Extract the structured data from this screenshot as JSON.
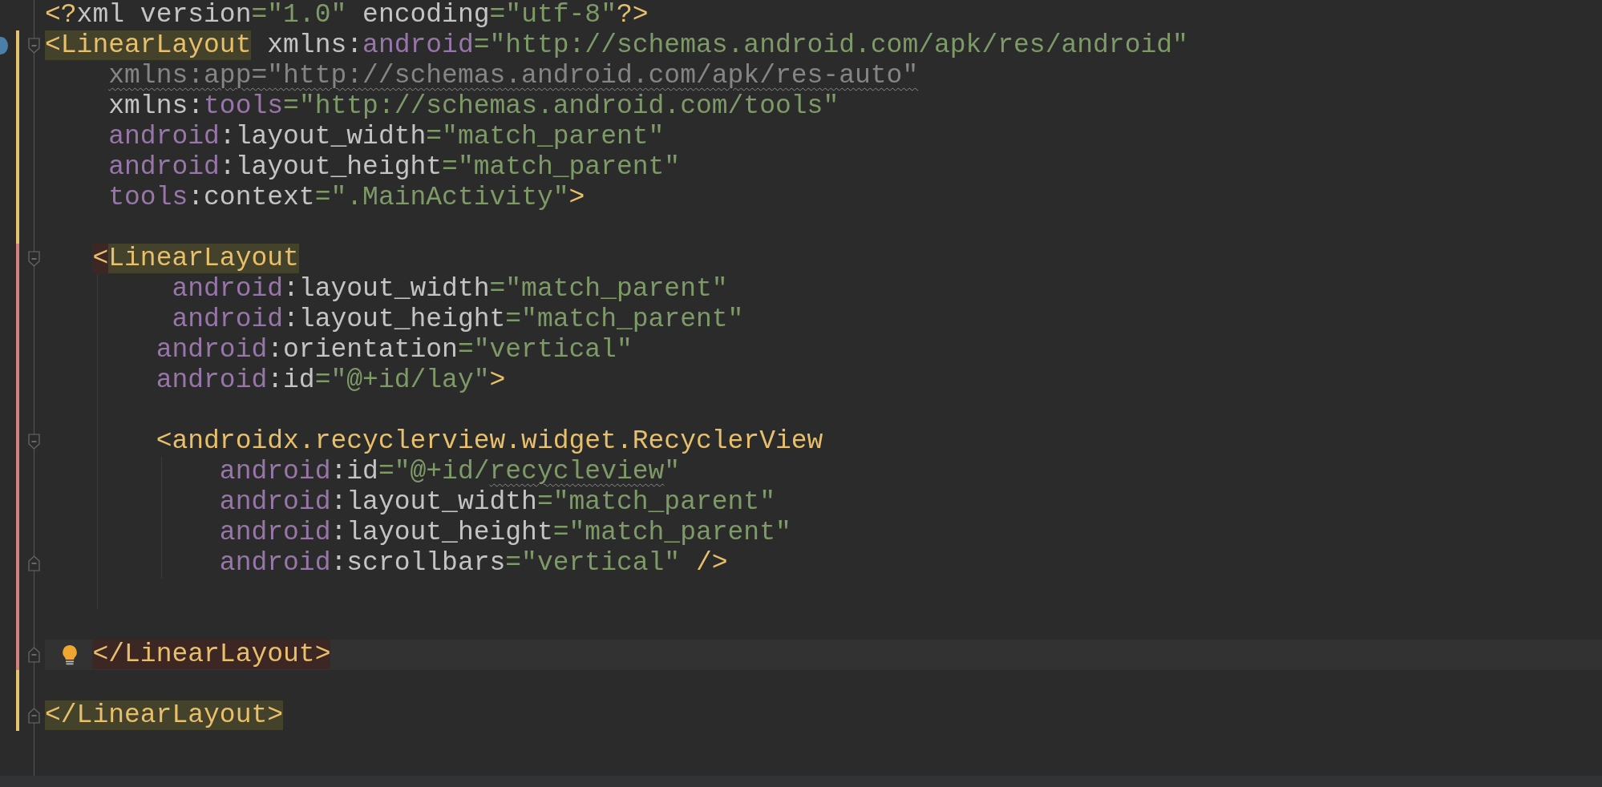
{
  "editor": {
    "lines": [
      {
        "tokens": [
          {
            "kind": "tag",
            "text": "<?"
          },
          {
            "kind": "attr",
            "text": "xml version"
          },
          {
            "kind": "value",
            "text": "=\"1.0\""
          },
          {
            "kind": "attr",
            "text": " encoding"
          },
          {
            "kind": "value",
            "text": "=\"utf-8\""
          },
          {
            "kind": "tag",
            "text": "?>"
          }
        ]
      },
      {
        "color": "#e3c46e",
        "dot": true,
        "fold_start": true,
        "tokens": [
          {
            "kind": "tag",
            "text": "<LinearLayout",
            "matched": true
          },
          {
            "kind": "attr",
            "text": " xmlns:"
          },
          {
            "kind": "ns",
            "text": "android"
          },
          {
            "kind": "value",
            "text": "=\"http://schemas.android.com/apk/res/android\""
          }
        ]
      },
      {
        "color": "#e3c46e",
        "tokens": [
          {
            "kind": "unused",
            "text": "    xmlns:app=\"http://schemas.android.com/apk/res-auto\"",
            "squiggle": true
          }
        ]
      },
      {
        "color": "#e3c46e",
        "tokens": [
          {
            "kind": "attr",
            "text": "    xmlns:"
          },
          {
            "kind": "ns",
            "text": "tools"
          },
          {
            "kind": "value",
            "text": "=\"http://schemas.android.com/tools\""
          }
        ]
      },
      {
        "color": "#e3c46e",
        "tokens": [
          {
            "kind": "ns",
            "text": "    android"
          },
          {
            "kind": "attr",
            "text": ":layout_width"
          },
          {
            "kind": "value",
            "text": "=\"match_parent\""
          }
        ]
      },
      {
        "color": "#e3c46e",
        "tokens": [
          {
            "kind": "ns",
            "text": "    android"
          },
          {
            "kind": "attr",
            "text": ":layout_height"
          },
          {
            "kind": "value",
            "text": "=\"match_parent\""
          }
        ]
      },
      {
        "color": "#e3c46e",
        "tokens": [
          {
            "kind": "ns",
            "text": "    tools"
          },
          {
            "kind": "attr",
            "text": ":context"
          },
          {
            "kind": "value",
            "text": "=\".MainActivity\""
          },
          {
            "kind": "tag",
            "text": ">"
          }
        ]
      },
      {
        "color": "#e3c46e"
      },
      {
        "color": "#d67f7f",
        "fold_start": true,
        "tokens": [
          {
            "kind": "tag",
            "text": "   <",
            "error": true
          },
          {
            "kind": "tag",
            "text": "LinearLayout",
            "matched": true
          }
        ]
      },
      {
        "color": "#d67f7f",
        "tokens": [
          {
            "kind": "ns",
            "text": "        android"
          },
          {
            "kind": "attr",
            "text": ":layout_width"
          },
          {
            "kind": "value",
            "text": "=\"match_parent\""
          }
        ]
      },
      {
        "color": "#d67f7f",
        "tokens": [
          {
            "kind": "ns",
            "text": "        android"
          },
          {
            "kind": "attr",
            "text": ":layout_height"
          },
          {
            "kind": "value",
            "text": "=\"match_parent\""
          }
        ]
      },
      {
        "color": "#d67f7f",
        "tokens": [
          {
            "kind": "ns",
            "text": "       android"
          },
          {
            "kind": "attr",
            "text": ":orientation"
          },
          {
            "kind": "value",
            "text": "=\"vertical\""
          }
        ]
      },
      {
        "color": "#d67f7f",
        "tokens": [
          {
            "kind": "ns",
            "text": "       android"
          },
          {
            "kind": "attr",
            "text": ":id"
          },
          {
            "kind": "value",
            "text": "=\"@+id/lay\""
          },
          {
            "kind": "tag",
            "text": ">"
          }
        ]
      },
      {
        "color": "#d67f7f"
      },
      {
        "color": "#d67f7f",
        "fold_start": true,
        "tokens": [
          {
            "kind": "tag",
            "text": "       <androidx.recyclerview.widget.RecyclerView"
          }
        ]
      },
      {
        "color": "#d67f7f",
        "tokens": [
          {
            "kind": "ns",
            "text": "           android"
          },
          {
            "kind": "attr",
            "text": ":id"
          },
          {
            "kind": "value",
            "text": "=\"@+id/"
          },
          {
            "kind": "value",
            "text": "recycleview",
            "squiggle": true
          },
          {
            "kind": "value",
            "text": "\""
          }
        ]
      },
      {
        "color": "#d67f7f",
        "tokens": [
          {
            "kind": "ns",
            "text": "           android"
          },
          {
            "kind": "attr",
            "text": ":layout_width"
          },
          {
            "kind": "value",
            "text": "=\"match_parent\""
          }
        ]
      },
      {
        "color": "#d67f7f",
        "tokens": [
          {
            "kind": "ns",
            "text": "           android"
          },
          {
            "kind": "attr",
            "text": ":layout_height"
          },
          {
            "kind": "value",
            "text": "=\"match_parent\""
          }
        ]
      },
      {
        "color": "#d67f7f",
        "fold_end": true,
        "tokens": [
          {
            "kind": "ns",
            "text": "           android"
          },
          {
            "kind": "attr",
            "text": ":scrollbars"
          },
          {
            "kind": "value",
            "text": "=\"vertical\""
          },
          {
            "kind": "tag",
            "text": " />"
          }
        ]
      },
      {
        "color": "#d67f7f"
      },
      {
        "color": "#d67f7f"
      },
      {
        "color": "#d67f7f",
        "fold_end": true,
        "current": true,
        "bulb": true,
        "tokens": [
          {
            "kind": "tag",
            "text": "   </LinearLayout>",
            "error": true
          }
        ]
      },
      {
        "color": "#e3c46e"
      },
      {
        "color": "#e3c46e",
        "fold_end": true,
        "tokens": [
          {
            "kind": "tag",
            "text": "</LinearLayout>",
            "matched": true
          }
        ]
      }
    ]
  }
}
